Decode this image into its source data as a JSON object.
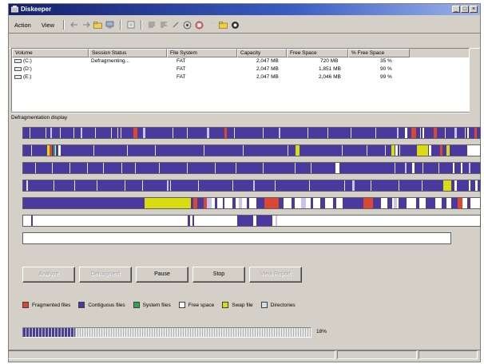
{
  "window": {
    "title": "Diskeeper"
  },
  "menu": {
    "action": "Action",
    "view": "View"
  },
  "toolbar": {
    "icons": [
      "back-arrow-icon",
      "forward-arrow-icon",
      "folder-icon",
      "computer-icon",
      "properties-icon",
      "list-icon",
      "list-detail-icon",
      "wand-icon",
      "defrag-icon",
      "stop-icon",
      "separator",
      "folder-open-icon",
      "settings-icon"
    ]
  },
  "table": {
    "headers": [
      "Volume",
      "Session Status",
      "File System",
      "Capacity",
      "Free Space",
      "% Free Space"
    ],
    "rows": [
      [
        "(C:)",
        "Defragmenting...",
        "FAT",
        "2,047 MB",
        "720 MB",
        "35 %"
      ],
      [
        "(D:)",
        "",
        "FAT",
        "2,047 MB",
        "1,851 MB",
        "90 %"
      ],
      [
        "(E:)",
        "",
        "FAT",
        "2,047 MB",
        "2,046 MB",
        "99 %"
      ]
    ]
  },
  "defrag": {
    "label": "Defragmentation display"
  },
  "buttons": {
    "analyze": "Analyze",
    "defragment": "Defragment",
    "pause": "Pause",
    "stop": "Stop",
    "view_report": "View Report"
  },
  "legend": {
    "fragmented": "Fragmented files",
    "contiguous": "Contiguous files",
    "system": "System files",
    "free": "Free space",
    "swap": "Swap file",
    "directories": "Directories"
  },
  "colors": {
    "fragmented": "#d9482f",
    "contiguous": "#4a3aa0",
    "system": "#2aa84a",
    "free": "#ffffff",
    "swap": "#d8dc10",
    "directories": "#c8e4f0",
    "accent_title": "#14206a"
  },
  "progress": {
    "value": 0.18,
    "label": "18%"
  }
}
